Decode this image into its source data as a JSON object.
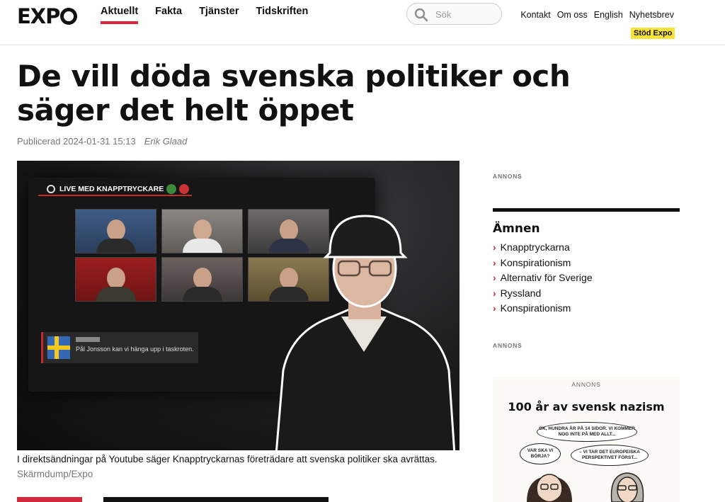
{
  "header": {
    "logo": "EXP",
    "nav": [
      {
        "label": "Aktuellt",
        "active": true
      },
      {
        "label": "Fakta",
        "active": false
      },
      {
        "label": "Tjänster",
        "active": false
      },
      {
        "label": "Tidskriften",
        "active": false
      }
    ],
    "search_placeholder": "Sök",
    "topnav": [
      "Kontakt",
      "Om oss",
      "English",
      "Nyhetsbrev"
    ],
    "support_label": "Stöd Expo",
    "accent_color": "#d1293d",
    "support_color": "#f7e339"
  },
  "article": {
    "headline": "De vill döda svenska politiker och säger det helt öppet",
    "published_label": "Publicerad 2024-01-31 15:13",
    "author": "Erik Glaad",
    "image": {
      "live_banner": "LIVE MED KNAPPTRYCKARE",
      "chat_text": "Pål Jonsson kan vi hänga upp i taskroten."
    },
    "caption": "I direktsändningar på Youtube säger Knapptryckarnas företrädare att svenska politiker ska avrättas.",
    "credit": "Skärmdump/Expo"
  },
  "sidebar": {
    "annons_1": "ANNONS",
    "topics_title": "Ämnen",
    "topics": [
      "Knapptryckarna",
      "Konspirationism",
      "Alternativ för Sverige",
      "Ryssland",
      "Konspirationism"
    ],
    "annons_2": "ANNONS",
    "ad": {
      "label": "ANNONS",
      "title": "100 år av svensk nazism",
      "bubble_1": "OK, HUNDRA ÅR PÅ 14 SIDOR. VI KOMMER NOG INTE PÅ MED ALLT...",
      "bubble_2": "VAR SKA VI BÖRJA?",
      "bubble_3": "– VI TAR DET EUROPEISKA PERSPEKTIVET FÖRST..."
    }
  }
}
